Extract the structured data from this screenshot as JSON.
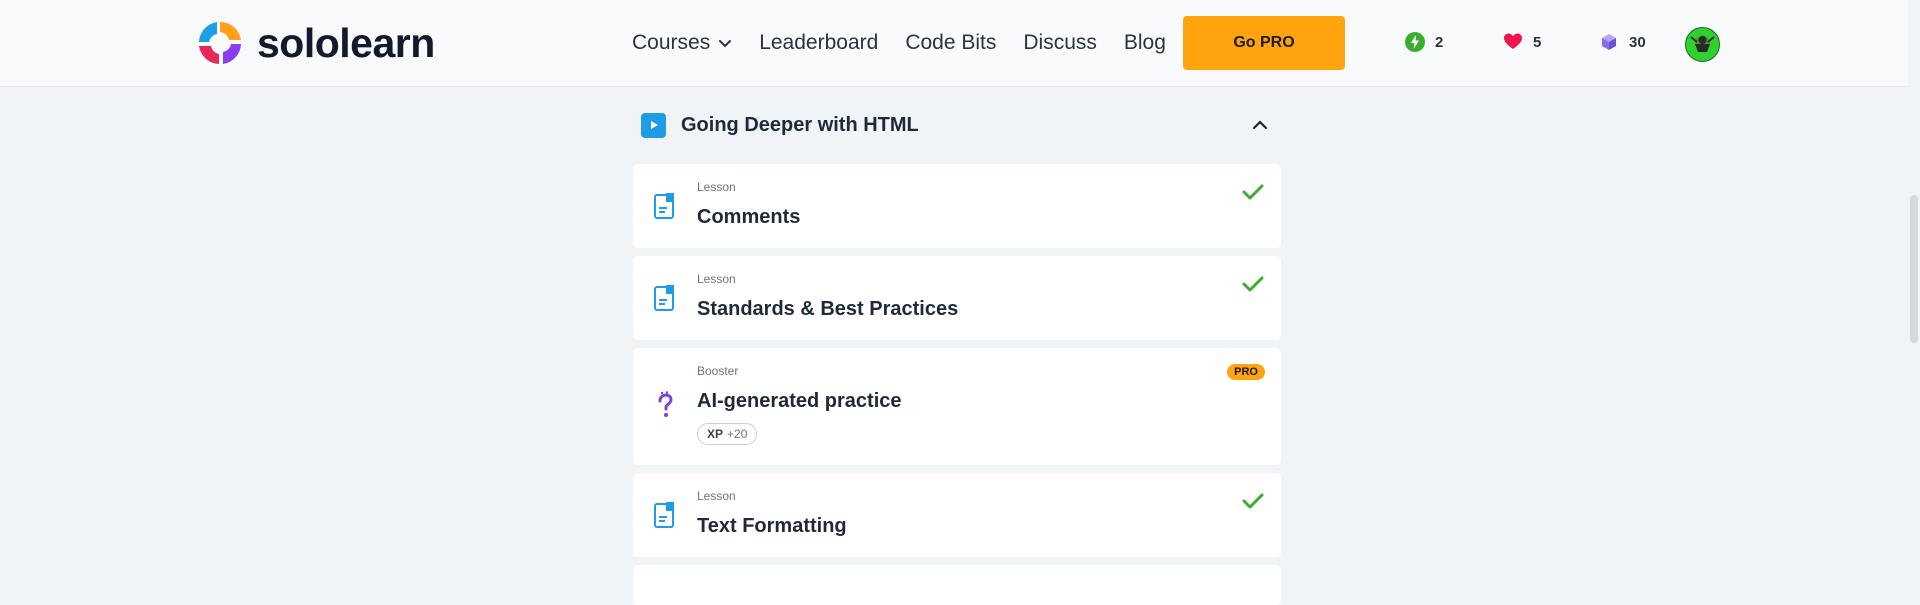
{
  "brand": {
    "name": "sololearn"
  },
  "nav": {
    "items": [
      {
        "label": "Courses"
      },
      {
        "label": "Leaderboard"
      },
      {
        "label": "Code Bits"
      },
      {
        "label": "Discuss"
      },
      {
        "label": "Blog"
      }
    ],
    "go_pro": "Go PRO"
  },
  "stats": {
    "streak": "2",
    "hearts": "5",
    "gems": "30"
  },
  "section": {
    "title": "Going Deeper with HTML"
  },
  "items": [
    {
      "type": "Lesson",
      "title": "Comments",
      "completed": true
    },
    {
      "type": "Lesson",
      "title": "Standards & Best Practices",
      "completed": true
    },
    {
      "type": "Booster",
      "title": "AI-generated practice",
      "badge": "PRO",
      "xp_label": "XP",
      "xp_value": "+20"
    },
    {
      "type": "Lesson",
      "title": "Text Formatting",
      "completed": true
    }
  ],
  "colors": {
    "accent": "#ffa30f",
    "check": "#3cae2f",
    "play": "#1e9ce6",
    "lesson_icon": "#1e9ce6"
  }
}
